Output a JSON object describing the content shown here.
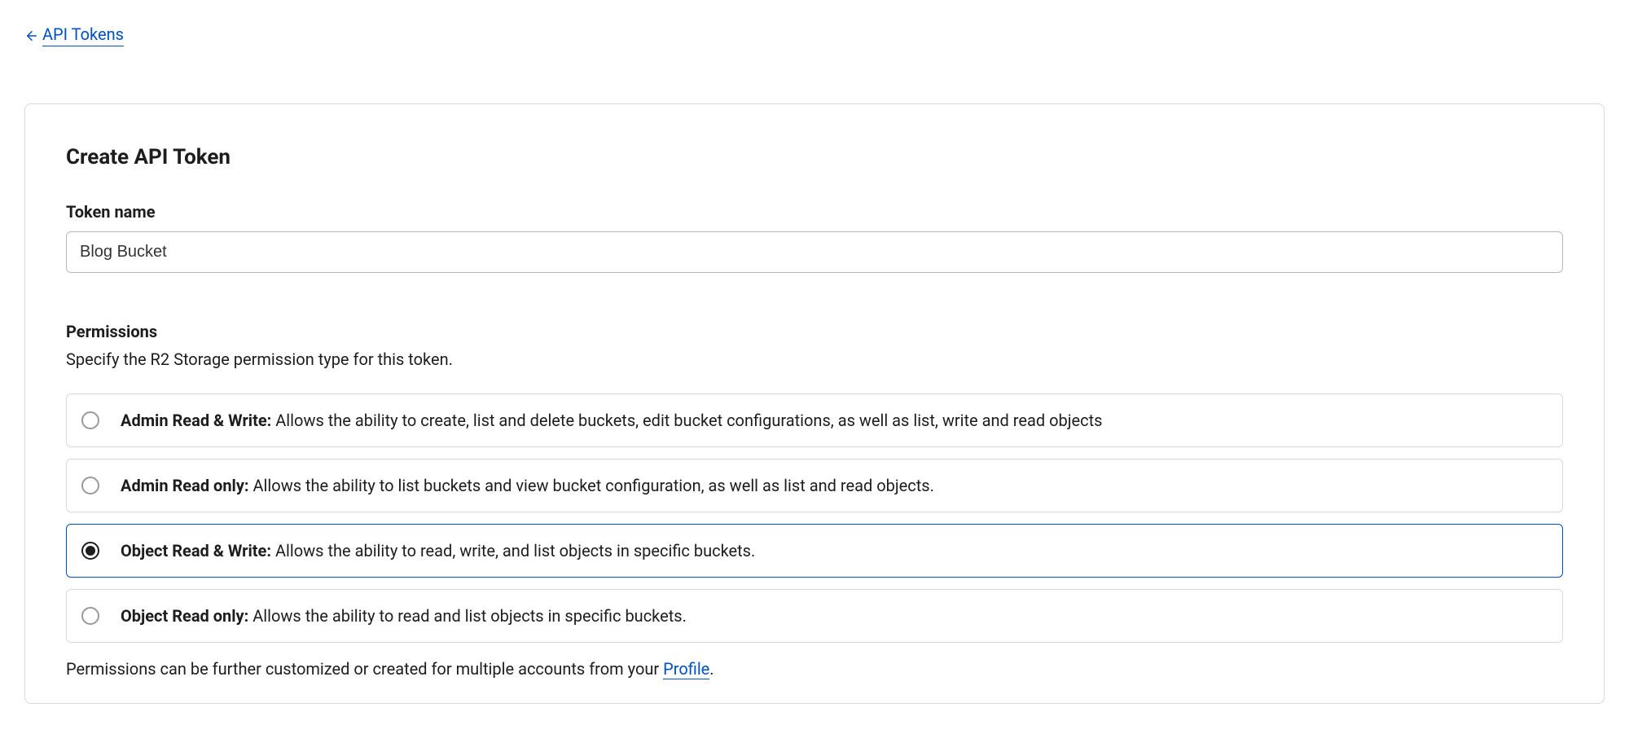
{
  "breadcrumb": {
    "back_label": "API Tokens"
  },
  "page": {
    "title": "Create API Token"
  },
  "token_name": {
    "label": "Token name",
    "value": "Blog Bucket"
  },
  "permissions": {
    "title": "Permissions",
    "description": "Specify the R2 Storage permission type for this token.",
    "selected_index": 2,
    "options": [
      {
        "title": "Admin Read & Write:",
        "description": " Allows the ability to create, list and delete buckets, edit bucket configurations, as well as list, write and read objects"
      },
      {
        "title": "Admin Read only:",
        "description": " Allows the ability to list buckets and view bucket configuration, as well as list and read objects."
      },
      {
        "title": "Object Read & Write:",
        "description": " Allows the ability to read, write, and list objects in specific buckets."
      },
      {
        "title": "Object Read only:",
        "description": " Allows the ability to read and list objects in specific buckets."
      }
    ],
    "footer_prefix": "Permissions can be further customized or created for multiple accounts from your ",
    "footer_link": "Profile",
    "footer_suffix": "."
  }
}
